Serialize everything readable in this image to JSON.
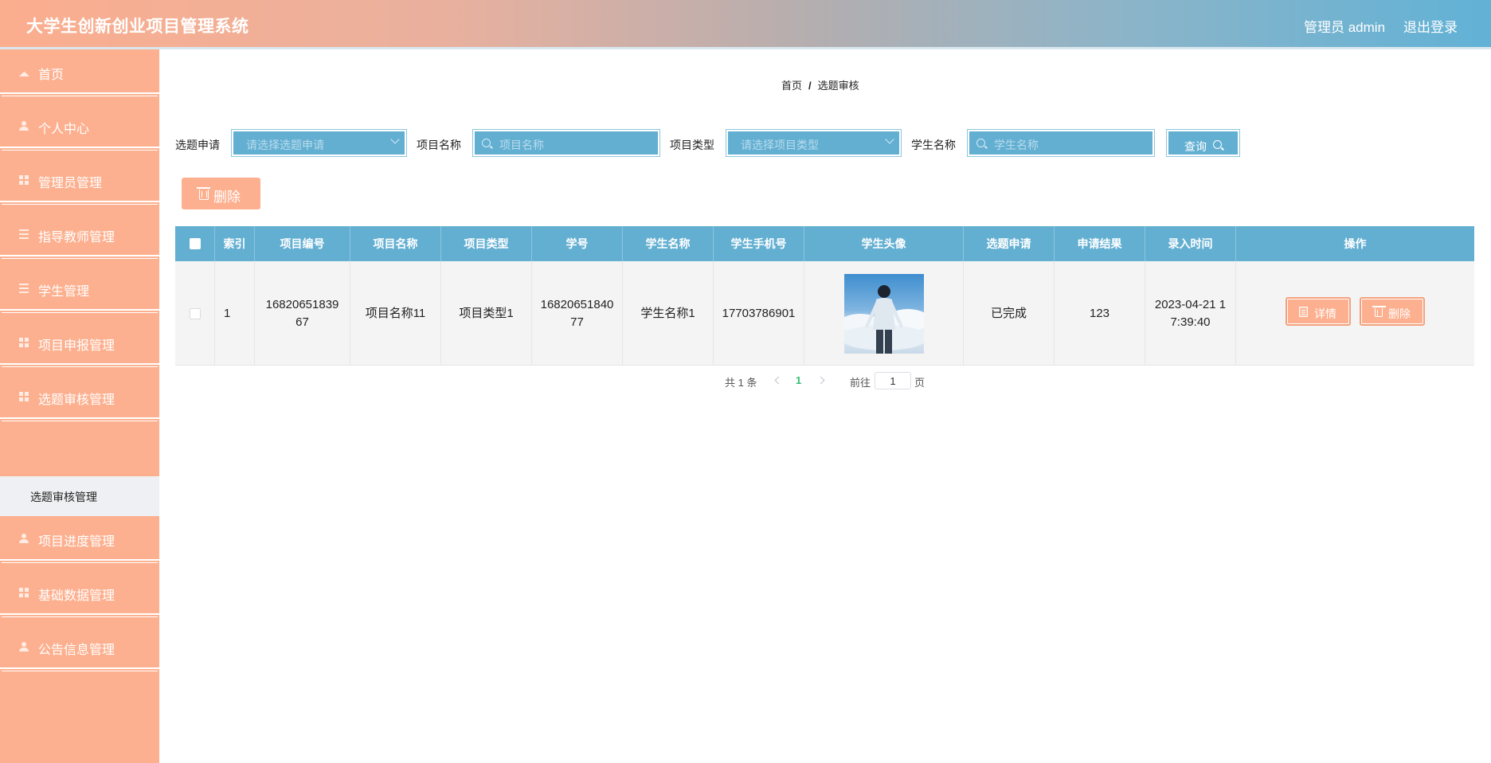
{
  "header": {
    "title": "大学生创新创业项目管理系统",
    "user": "管理员 admin",
    "logout": "退出登录"
  },
  "sidebar": {
    "items": [
      {
        "label": "首页",
        "icon": "home-icon"
      },
      {
        "label": "个人中心",
        "icon": "user-icon"
      },
      {
        "label": "管理员管理",
        "icon": "grid-icon"
      },
      {
        "label": "指导教师管理",
        "icon": "list-icon"
      },
      {
        "label": "学生管理",
        "icon": "list-icon"
      },
      {
        "label": "项目申报管理",
        "icon": "grid-icon"
      },
      {
        "label": "选题审核管理",
        "icon": "grid-icon"
      },
      {
        "label": "项目进度管理",
        "icon": "user-icon"
      },
      {
        "label": "基础数据管理",
        "icon": "grid-icon"
      },
      {
        "label": "公告信息管理",
        "icon": "user-icon"
      }
    ],
    "sub_item": "选题审核管理"
  },
  "breadcrumb": {
    "home": "首页",
    "sep": "/",
    "current": "选题审核"
  },
  "filters": {
    "topic_label": "选题申请",
    "topic_placeholder": "请选择选题申请",
    "project_name_label": "项目名称",
    "project_name_placeholder": "项目名称",
    "project_type_label": "项目类型",
    "project_type_placeholder": "请选择项目类型",
    "student_name_label": "学生名称",
    "student_name_placeholder": "学生名称",
    "query_button": "查询"
  },
  "toolbar": {
    "delete_label": "删除"
  },
  "table": {
    "columns": [
      "索引",
      "项目编号",
      "项目名称",
      "项目类型",
      "学号",
      "学生名称",
      "学生手机号",
      "学生头像",
      "选题申请",
      "申请结果",
      "录入时间",
      "操作"
    ],
    "rows": [
      {
        "index": "1",
        "project_no": "1682065183967",
        "project_name": "项目名称11",
        "project_type": "项目类型1",
        "student_no": "1682065184077",
        "student_name": "学生名称1",
        "phone": "17703786901",
        "topic_status": "已完成",
        "result": "123",
        "created_at": "2023-04-21 17:39:40",
        "detail_button": "详情",
        "delete_button": "删除"
      }
    ]
  },
  "pagination": {
    "total": "共 1 条",
    "current_page": "1",
    "goto_label": "前往",
    "goto_value": "1",
    "page_suffix": "页"
  }
}
